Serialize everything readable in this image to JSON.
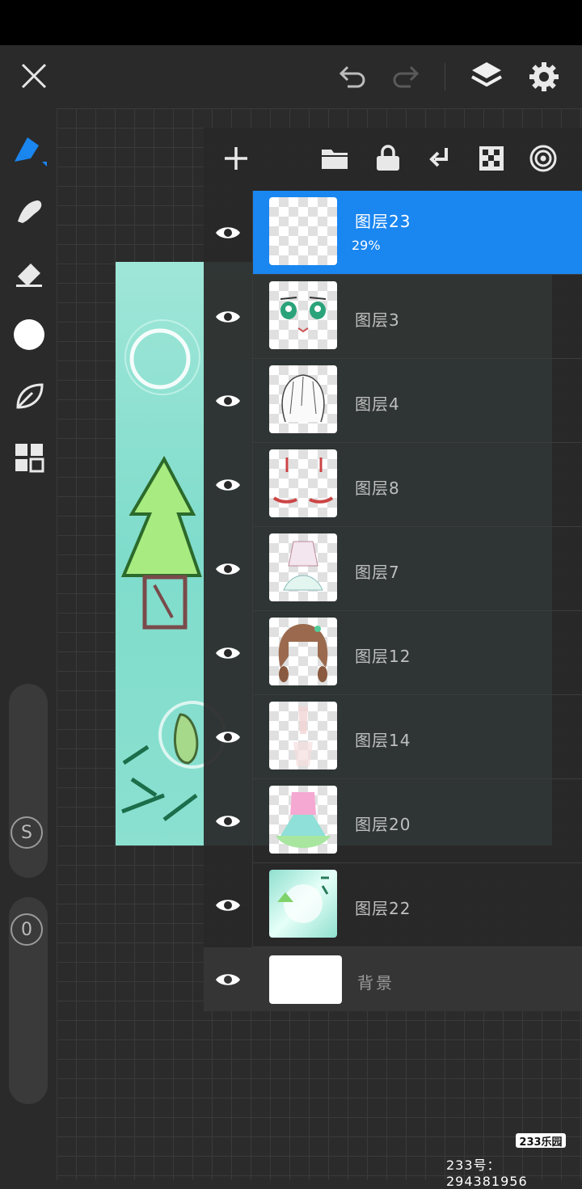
{
  "toolbar": {
    "close_icon": "close-icon",
    "undo_icon": "undo-icon",
    "redo_icon": "redo-icon",
    "layers_icon": "layers-icon",
    "settings_icon": "gear-icon"
  },
  "sidebar": {
    "tools": [
      "pen-icon",
      "smudge-icon",
      "eraser-icon",
      "color-swatch",
      "leaf-icon",
      "grid-icon"
    ],
    "size_label": "S",
    "opacity_label": "0"
  },
  "layers_panel": {
    "actions": [
      "add-layer",
      "folder",
      "lock",
      "merge-down",
      "transparency",
      "blend"
    ],
    "layers": [
      {
        "name": "图层23",
        "opacity": "29%",
        "selected": true
      },
      {
        "name": "图层3"
      },
      {
        "name": "图层4"
      },
      {
        "name": "图层8"
      },
      {
        "name": "图层7"
      },
      {
        "name": "图层12"
      },
      {
        "name": "图层14"
      },
      {
        "name": "图层20"
      },
      {
        "name": "图层22"
      }
    ],
    "background": {
      "name": "背景"
    }
  },
  "watermark": {
    "logo": "233乐园",
    "id_text": "233号： 294381956"
  },
  "colors": {
    "accent": "#1a86f0",
    "panel": "#282828",
    "canvas_bg": "#2b2b2b"
  }
}
